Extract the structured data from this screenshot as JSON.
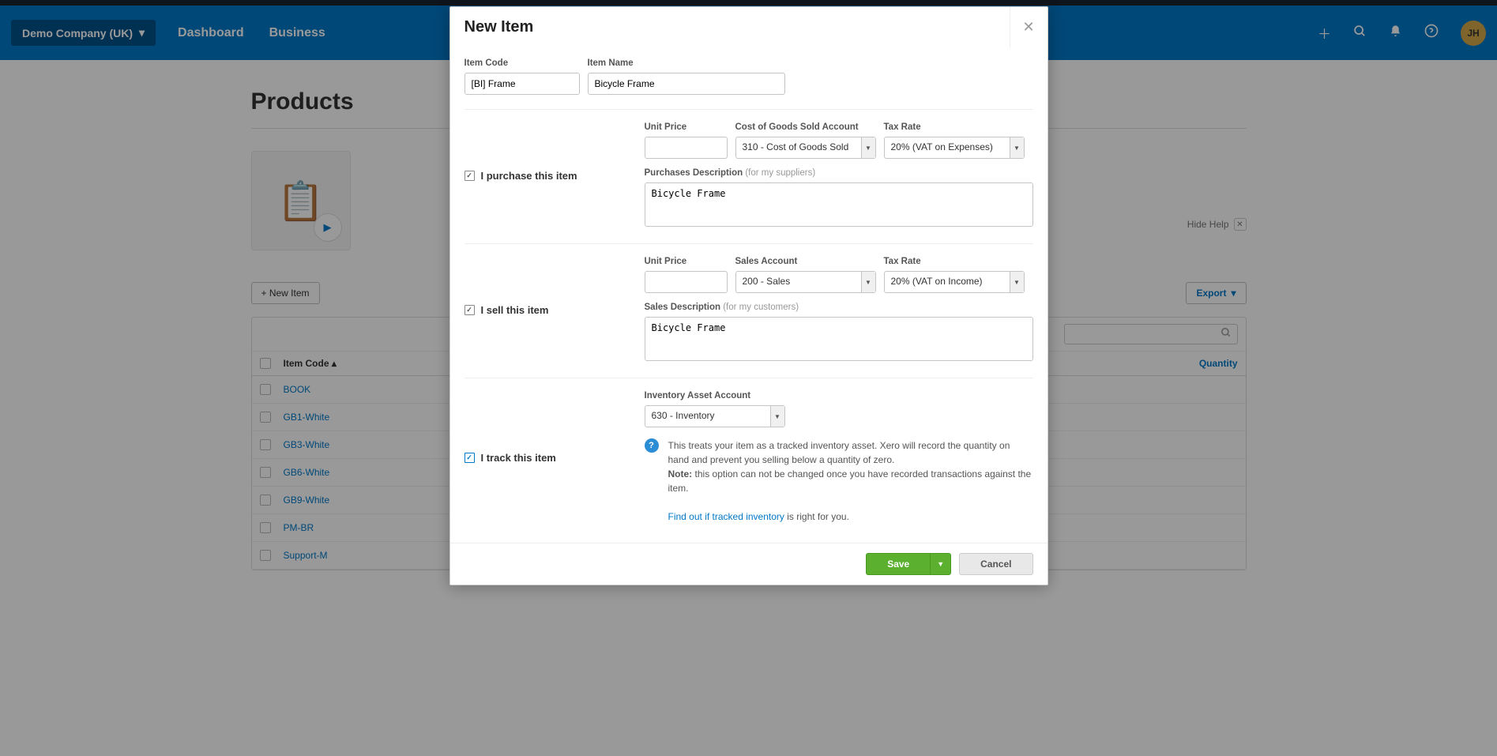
{
  "topbar": {
    "org_name": "Demo Company (UK)",
    "nav": [
      "Dashboard",
      "Business"
    ],
    "avatar": "JH"
  },
  "page": {
    "title": "Products",
    "hide_help": "Hide Help",
    "new_item_btn": "+ New Item",
    "export_btn": "Export",
    "columns": {
      "item_code": "Item Code",
      "quantity": "Quantity"
    },
    "rows": [
      {
        "code": "BOOK"
      },
      {
        "code": "GB1-White"
      },
      {
        "code": "GB3-White"
      },
      {
        "code": "GB6-White"
      },
      {
        "code": "GB9-White"
      },
      {
        "code": "PM-BR"
      },
      {
        "code": "Support-M"
      }
    ]
  },
  "modal": {
    "title": "New Item",
    "labels": {
      "item_code": "Item Code",
      "item_name": "Item Name",
      "purchase": "I purchase this item",
      "sell": "I sell this item",
      "track": "I track this item",
      "unit_price": "Unit Price",
      "cogs_account": "Cost of Goods Sold Account",
      "tax_rate": "Tax Rate",
      "purchases_desc": "Purchases Description",
      "purchases_desc_hint": "(for my suppliers)",
      "sales_account": "Sales Account",
      "sales_desc": "Sales Description",
      "sales_desc_hint": "(for my customers)",
      "inventory_account": "Inventory Asset Account"
    },
    "values": {
      "item_code": "[BI] Frame",
      "item_name": "Bicycle Frame",
      "purchase_unit_price": "",
      "cogs_account": "310 - Cost of Goods Sold",
      "purchase_tax": "20% (VAT on Expenses)",
      "purchases_desc": "Bicycle Frame",
      "sell_unit_price": "",
      "sales_account": "200 - Sales",
      "sell_tax": "20% (VAT on Income)",
      "sales_desc": "Bicycle Frame",
      "inventory_account": "630 - Inventory"
    },
    "help": {
      "line1": "This treats your item as a tracked inventory asset. Xero will record the quantity on hand and prevent you selling below a quantity of zero.",
      "note_label": "Note:",
      "note_text": "this option can not be changed once you have recorded transactions against the item.",
      "link_text": "Find out if tracked inventory",
      "link_tail": " is right for you."
    },
    "buttons": {
      "save": "Save",
      "cancel": "Cancel"
    }
  }
}
